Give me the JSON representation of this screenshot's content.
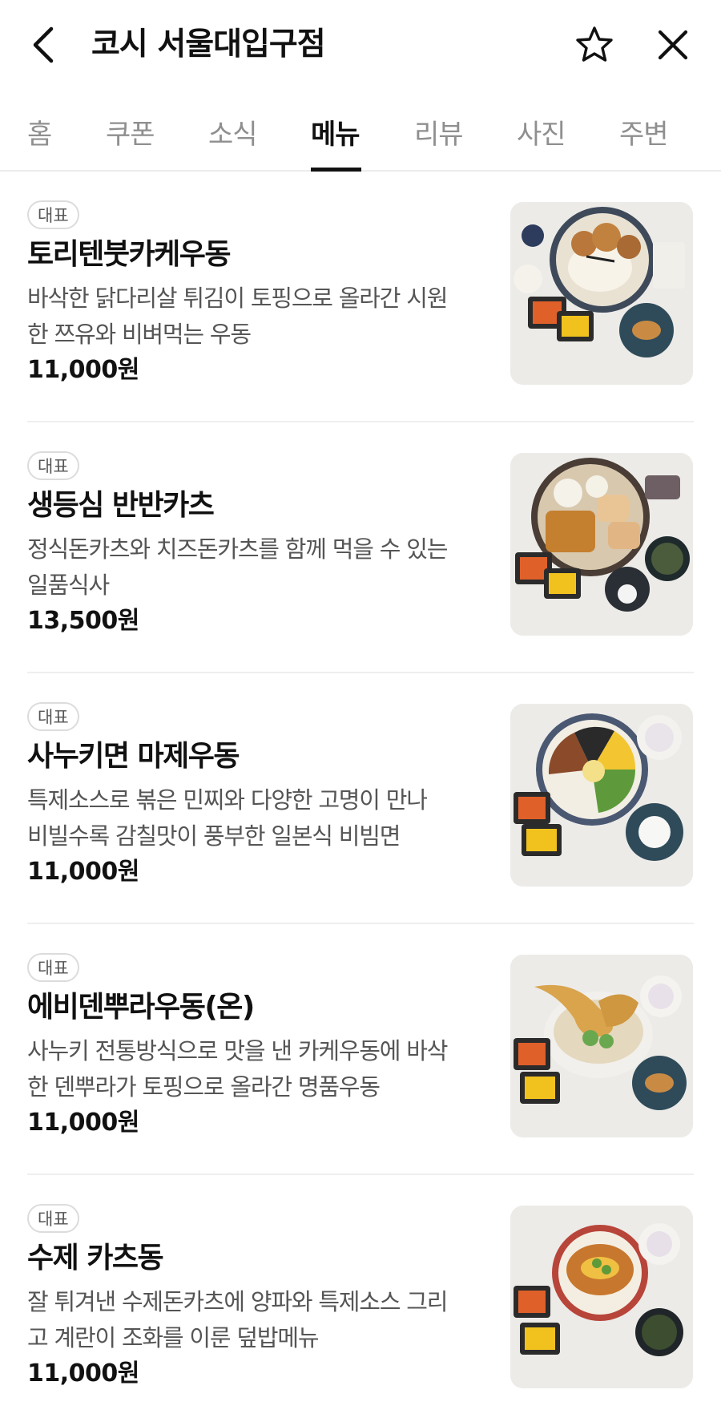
{
  "header": {
    "title": "코시 서울대입구점",
    "back_icon": "back-arrow-icon",
    "favorite_icon": "star-outline-icon",
    "close_icon": "close-icon"
  },
  "tabs": [
    {
      "label": "홈",
      "active": false
    },
    {
      "label": "쿠폰",
      "active": false
    },
    {
      "label": "소식",
      "active": false
    },
    {
      "label": "메뉴",
      "active": true
    },
    {
      "label": "리뷰",
      "active": false
    },
    {
      "label": "사진",
      "active": false
    },
    {
      "label": "주변",
      "active": false
    }
  ],
  "colors": {
    "accent_text": "#111111",
    "inactive_tab": "#8f8f8f",
    "description": "#555555",
    "divider": "#efefef"
  },
  "menu": {
    "items": [
      {
        "badge": "대표",
        "name": "토리텐붓카케우동",
        "desc_line1": "바삭한 닭다리살 튀김이 토핑으로 올라간 시원",
        "desc_line2": "한 쯔유와 비벼먹는 우동",
        "price": "11,000원"
      },
      {
        "badge": "대표",
        "name": "생등심 반반카츠",
        "desc_line1": "정식돈카츠와 치즈돈카츠를 함께 먹을 수 있는",
        "desc_line2": "일품식사",
        "price": "13,500원"
      },
      {
        "badge": "대표",
        "name": "사누키면 마제우동",
        "desc_line1": "특제소스로 볶은 민찌와 다양한 고명이 만나",
        "desc_line2": "비빌수록 감칠맛이 풍부한 일본식 비빔면",
        "price": "11,000원"
      },
      {
        "badge": "대표",
        "name": "에비덴뿌라우동(온)",
        "desc_line1": "사누키 전통방식으로 맛을 낸 카케우동에 바삭",
        "desc_line2": "한 덴뿌라가 토핑으로 올라간 명품우동",
        "price": "11,000원"
      },
      {
        "badge": "대표",
        "name": "수제 카츠동",
        "desc_line1": "잘 튀겨낸 수제돈카츠에 양파와 특제소스 그리",
        "desc_line2": "고 계란이 조화를 이룬 덮밥메뉴",
        "price": "11,000원"
      }
    ]
  }
}
